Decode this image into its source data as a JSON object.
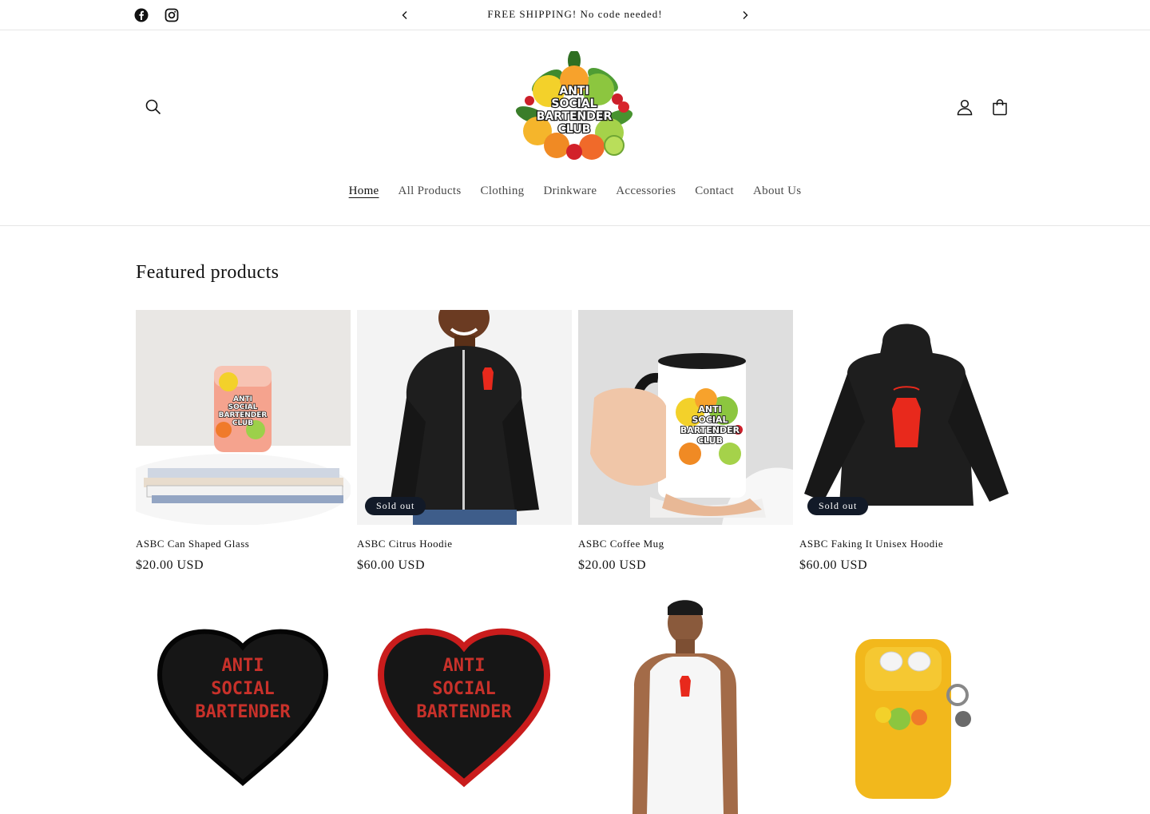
{
  "announcement": {
    "text": "FREE SHIPPING! No code needed!",
    "social": [
      "facebook-icon",
      "instagram-icon"
    ]
  },
  "header": {
    "logo_lines": [
      "ANTI",
      "SOCIAL",
      "BARTENDER",
      "CLUB"
    ],
    "nav": [
      "Home",
      "All Products",
      "Clothing",
      "Drinkware",
      "Accessories",
      "Contact",
      "About Us"
    ],
    "active_nav": "Home"
  },
  "featured": {
    "title": "Featured products",
    "products": [
      {
        "title": "ASBC Can Shaped Glass",
        "price": "$20.00 USD",
        "sold_out": false
      },
      {
        "title": "ASBC Citrus Hoodie",
        "price": "$60.00 USD",
        "sold_out": true,
        "badge": "Sold out"
      },
      {
        "title": "ASBC Coffee Mug",
        "price": "$20.00 USD",
        "sold_out": false
      },
      {
        "title": "ASBC Faking It Unisex Hoodie",
        "price": "$60.00 USD",
        "sold_out": true,
        "badge": "Sold out"
      }
    ],
    "second_row_text": {
      "patch_lines": [
        "ANTI",
        "SOCIAL",
        "BARTENDER"
      ]
    }
  },
  "colors": {
    "badge_bg": "#121a28",
    "divider": "#e6e6e6",
    "accent_red": "#e8291c"
  }
}
